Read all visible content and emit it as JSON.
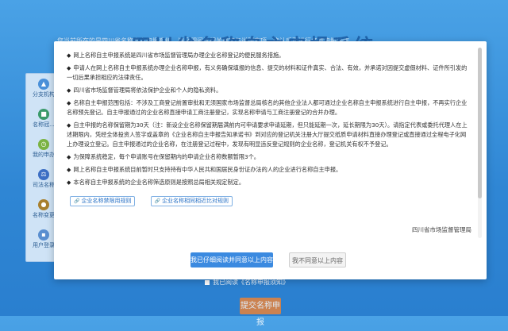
{
  "background": {
    "title": "四川省名称自主申报系统",
    "strip_text": "您当前所在的是四川省名称自主申报系统，请仔细阅读相关规定与说明事项，确认后再进行名称申报操作",
    "sidebar": [
      {
        "label": "分支机构",
        "icon": "branch-icon",
        "color": "#4a90d9",
        "glyph": "▲"
      },
      {
        "label": "名称冠...",
        "icon": "crown-icon",
        "color": "#3a9a6a",
        "glyph": "■"
      },
      {
        "label": "我的申办",
        "icon": "clock-icon",
        "color": "#7bb342",
        "glyph": "◷"
      },
      {
        "label": "司法名称",
        "icon": "law-icon",
        "color": "#3d6fc4",
        "glyph": "⚖"
      },
      {
        "label": "名称变更",
        "icon": "change-icon",
        "color": "#a8802f",
        "glyph": "●"
      },
      {
        "label": "用户登录",
        "icon": "user-icon",
        "color": "#5a8fd0",
        "glyph": "▪"
      }
    ],
    "checkbox_label": "我已阅读《名称申报须知》",
    "submit_label": "提交名称申报"
  },
  "notice": {
    "paragraphs": [
      "网上名称自主申报系统是四川省市场监督管理局办理企业名称登记的便民服务措施。",
      "申请人在网上名称自主申报系统办理企业名称申报，有义务确保填报的信息、提交的材料和证件真实、合法、有效，并承诺对因提交虚假材料、证件所引发的一切后果承担相应的法律责任。",
      "四川省市场监督管理局将依法保护企业和个人的隐私资料。",
      "名称自主申报范围包括：不涉及工商登记前置审批和无须国家市场监督总局核名的其他企业法人都可通过企业名称自主申报系统进行自主申报，不再实行企业名称预先登记。自主申报通过的企业名称直接申请工商注册登记，实现名称申请与工商注册登记的合并办理。",
      "自主申报的名称保留期为30天（注：新设企业名称保留期届满前内可申请要求申请延期，但只能延期一次，延长期限为30天）。请指定代表或委托代理人在上述期限内，凭经全体投资人签字或盖章的《企业名称自主申报告知承诺书》到对应的登记机关注册大厅提交纸质申请材料直接办理登记或直接通过全程电子化网上办理设立登记。自主申报通过的企业名称，在注册登记过程中，发现有明显违反登记规则的企业名称，登记机关有权不予登记。",
      "为保障系统稳定，每个申请账号在保留期内的申请企业名称数额暂限3个。",
      "网上名称自主申报系统目前暂时只支持持有中华人民共和国居民身份证办法的人的企业进行名称自主申报。",
      "本名称自主申报系统的企业名称筛选原则是按照总局相关规定制定。"
    ],
    "links": [
      "企业名称禁限用规则",
      "企业名称相同相近比对规则"
    ],
    "signature": "四川省市场监督管理局",
    "agree_label": "我已仔细阅读并同意以上内容",
    "disagree_label": "我不同意以上内容"
  }
}
